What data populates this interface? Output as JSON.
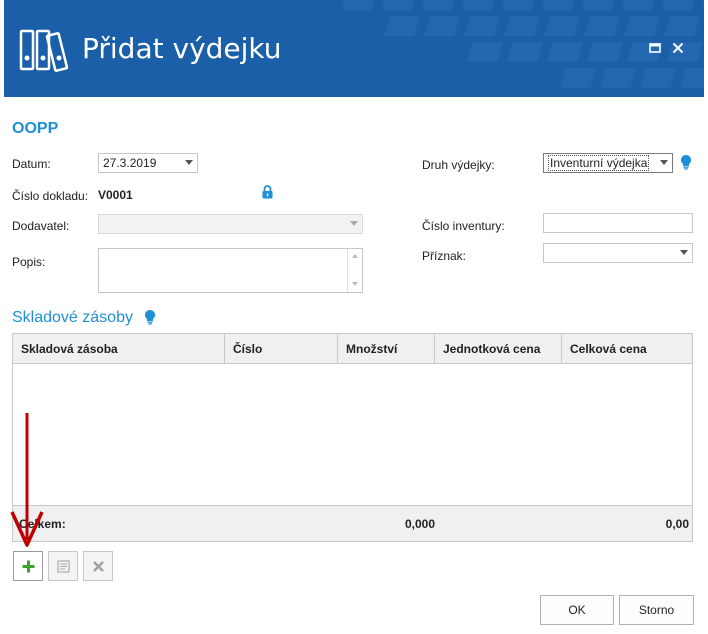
{
  "window": {
    "title": "Přidat výdejku",
    "maximize_icon": "maximize-icon",
    "close_icon": "close-icon",
    "accent_color": "#1a5fa8"
  },
  "form": {
    "section_title": "OOPP",
    "datum_label": "Datum:",
    "datum_value": "27.3.2019",
    "cislo_dokladu_label": "Číslo dokladu:",
    "cislo_dokladu_value": "V0001",
    "dodavatel_label": "Dodavatel:",
    "dodavatel_value": "",
    "popis_label": "Popis:",
    "popis_value": "",
    "druh_vydejky_label": "Druh výdejky:",
    "druh_vydejky_value": "Inventurní výdejka",
    "cislo_inventury_label": "Číslo inventury:",
    "cislo_inventury_value": "",
    "priznak_label": "Příznak:",
    "priznak_value": ""
  },
  "stock": {
    "title": "Skladové zásoby",
    "columns": [
      "Skladová zásoba",
      "Číslo",
      "Množství",
      "Jednotková cena",
      "Celková cena"
    ],
    "rows": [],
    "footer_label": "Celkem:",
    "footer_quantity": "0,000",
    "footer_total": "0,00"
  },
  "toolbar": {
    "add_icon": "plus-icon",
    "edit_icon": "document-icon",
    "delete_icon": "x-icon"
  },
  "buttons": {
    "ok": "OK",
    "cancel": "Storno"
  },
  "colors": {
    "accent": "#1f8fd6",
    "annotation_arrow": "#c00000",
    "add_green": "#3aa52a"
  }
}
